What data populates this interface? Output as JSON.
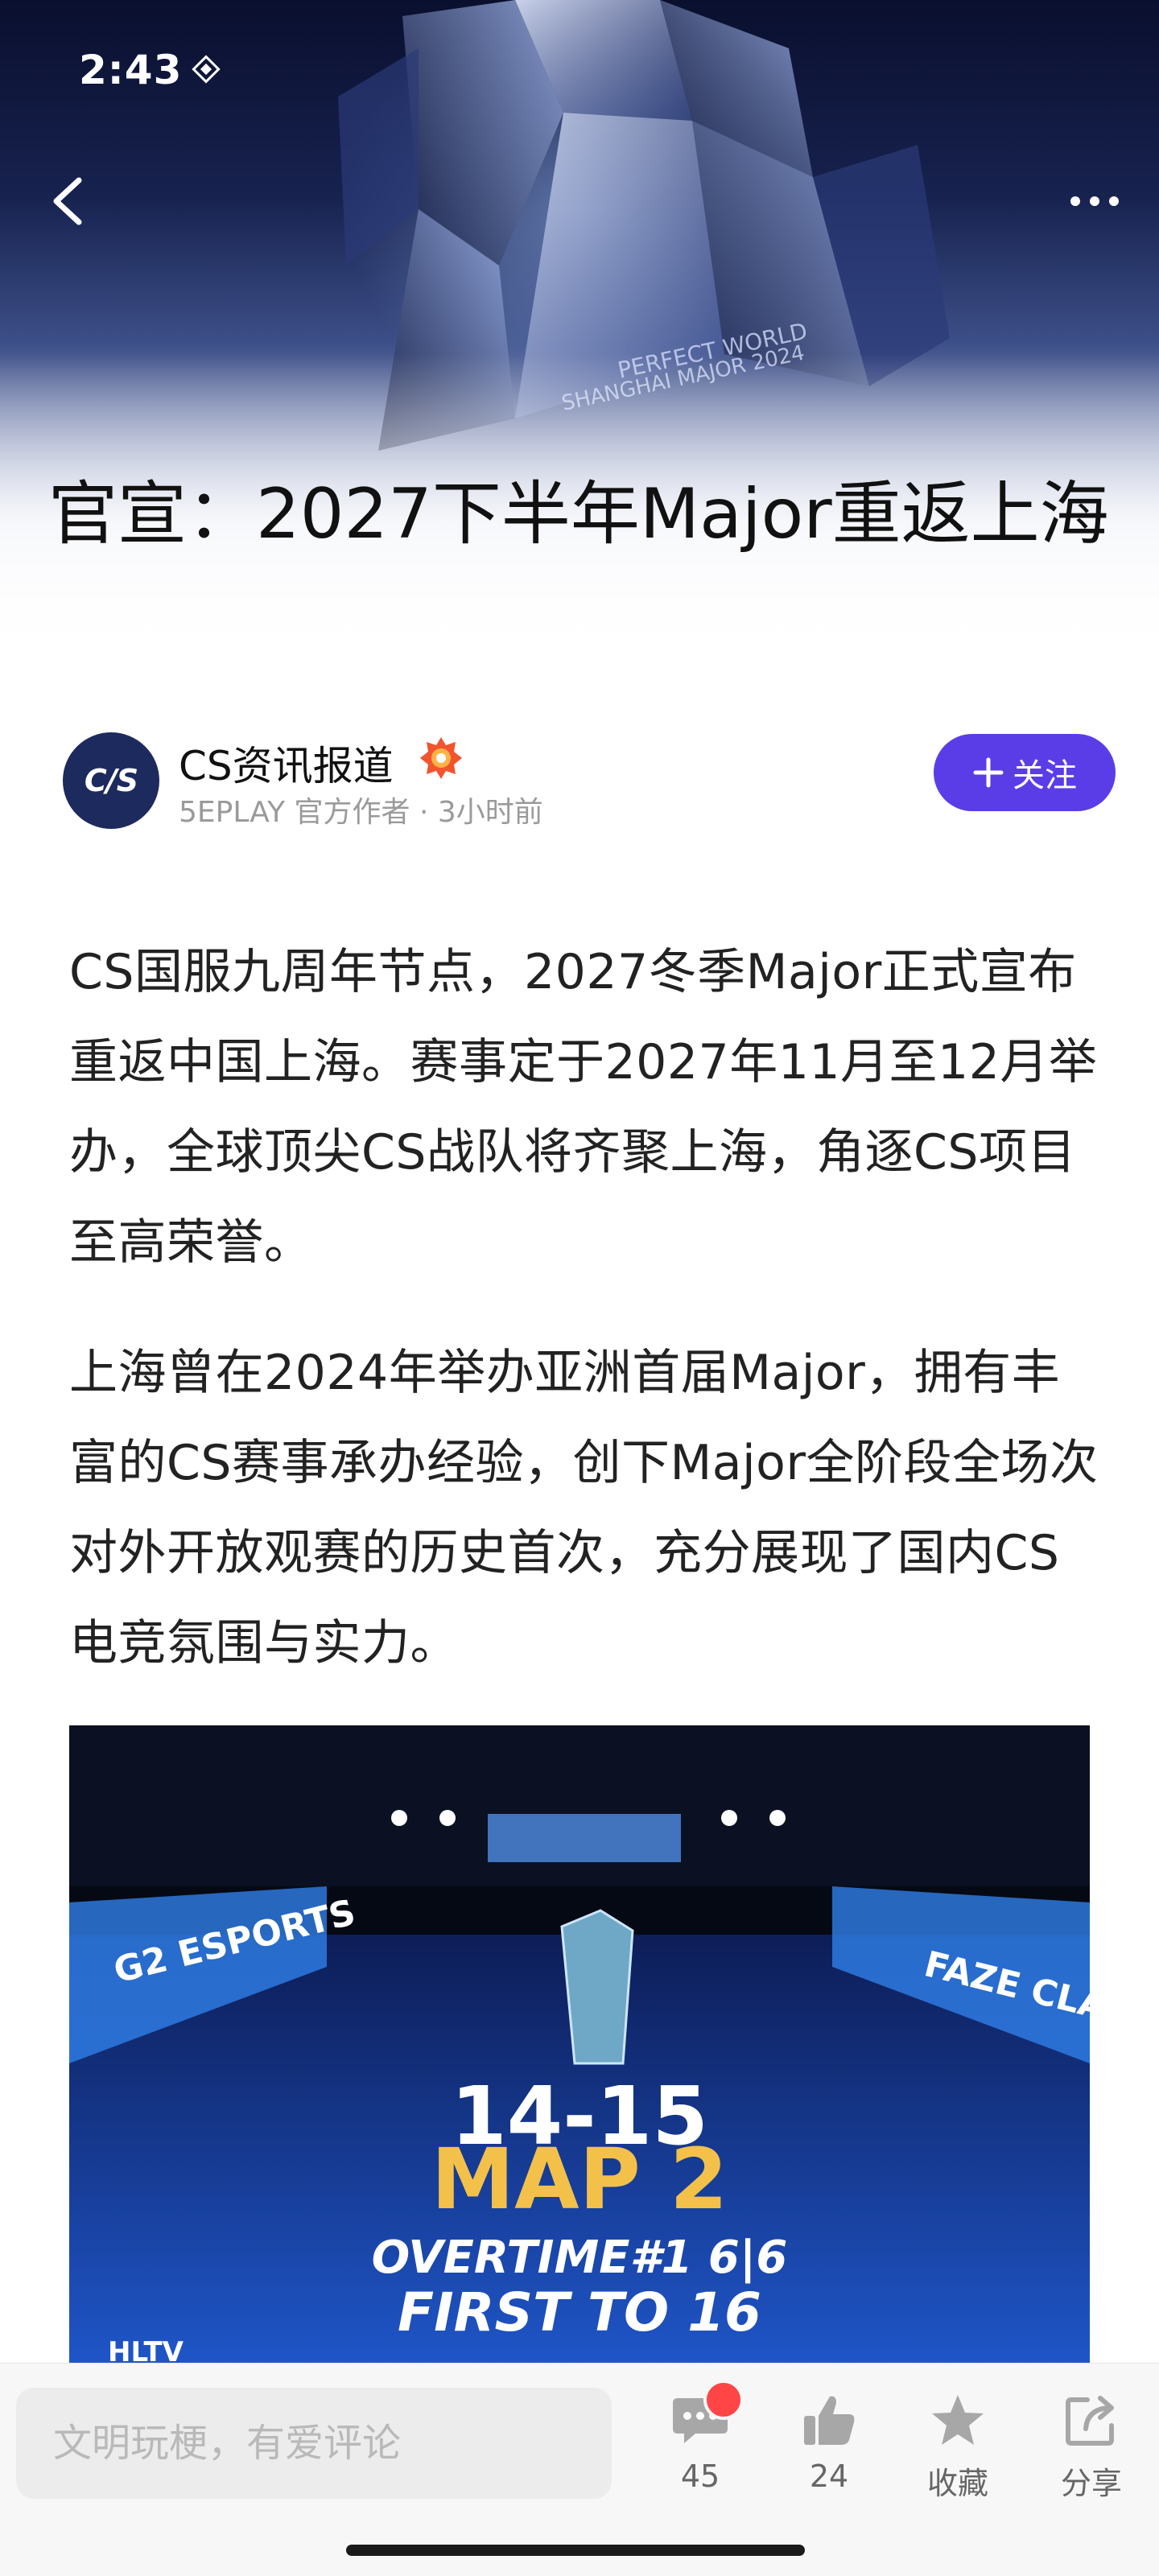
{
  "status_bar": {
    "time": "2:43"
  },
  "hero": {
    "title": "官宣：2027下半年Major重返上海"
  },
  "author": {
    "avatar_text": "C/S",
    "name": "CS资讯报道",
    "meta": "5EPLAY 官方作者 · 3小时前",
    "follow_label": "关注"
  },
  "article": {
    "paragraphs": [
      "CS国服九周年节点，2027冬季Major正式宣布重返中国上海。赛事定于2027年11月至12月举办，全球顶尖CS战队将齐聚上海，角逐CS项目至高荣誉。",
      "上海曾在2024年举办亚洲首届Major，拥有丰富的CS赛事承办经验，创下Major全阶段全场次对外开放观赛的历史首次，充分展现了国内CS电竞氛围与实力。"
    ],
    "image": {
      "score": "14-15",
      "map": "MAP 2",
      "line1": "OVERTIME#1 6|6",
      "line2": "FIRST TO 16",
      "team_left": "G2 ESPORTS",
      "team_right": "FAZE CLAN",
      "watermark": "HLTV"
    }
  },
  "bottom_bar": {
    "comment_placeholder": "文明玩梗，有爱评论",
    "comments_count": "45",
    "likes_count": "24",
    "favorite_label": "收藏",
    "share_label": "分享"
  },
  "colors": {
    "accent": "#5b3de8",
    "badge": "#ff4545"
  }
}
